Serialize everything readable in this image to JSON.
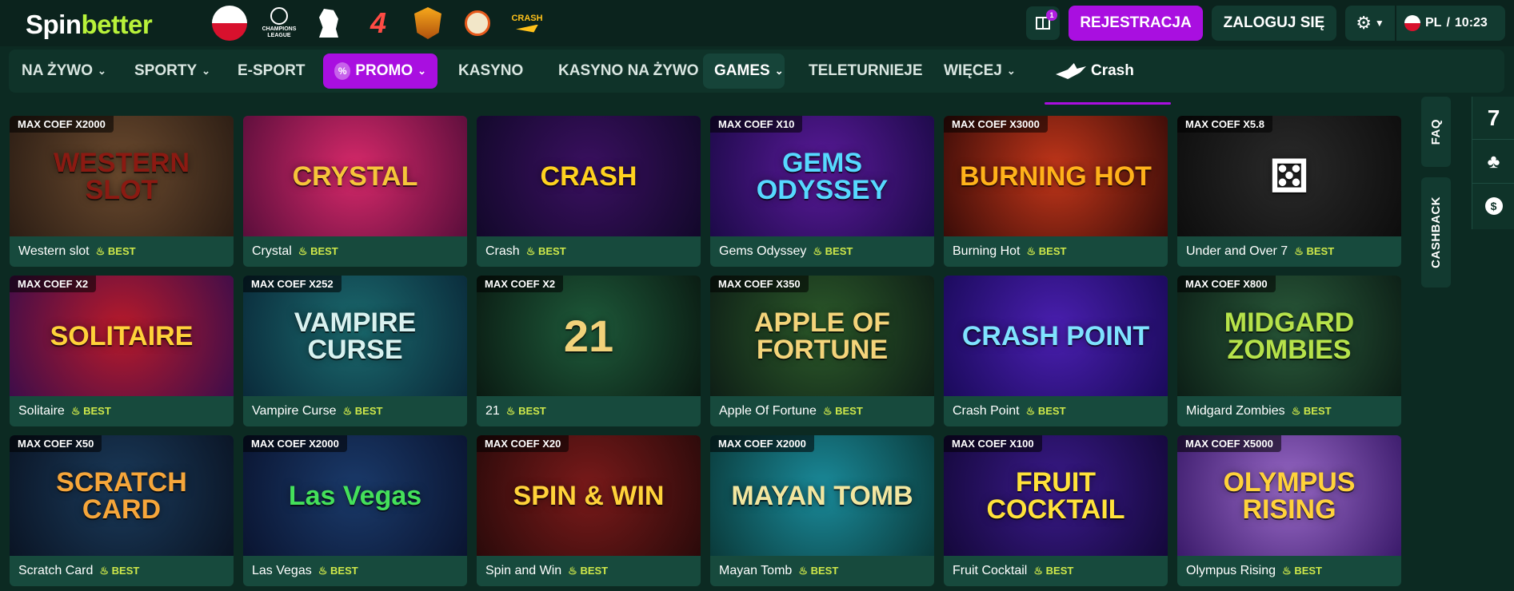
{
  "brand": {
    "logo_part1": "Spin",
    "logo_part2": "better"
  },
  "promo_icons": [
    {
      "name": "poland-flag-icon"
    },
    {
      "name": "champions-league-icon",
      "label": "CHAMPIONS LEAGUE"
    },
    {
      "name": "premier-league-icon"
    },
    {
      "name": "laliga-icon"
    },
    {
      "name": "olympus-icon"
    },
    {
      "name": "chicken-icon"
    },
    {
      "name": "crash-promo-icon",
      "label": "CRASH"
    }
  ],
  "header": {
    "gift_count": "1",
    "register_label": "REJESTRACJA",
    "login_label": "ZALOGUJ SIĘ",
    "lang_label": "PL",
    "separator": "/",
    "time": "10:23"
  },
  "nav": {
    "items": [
      {
        "label": "NA ŻYWO"
      },
      {
        "label": "SPORTY"
      },
      {
        "label": "E-SPORT"
      },
      {
        "label": "PROMO"
      },
      {
        "label": "KASYNO"
      },
      {
        "label": "KASYNO NA ŻYWO"
      },
      {
        "label": "GAMES"
      },
      {
        "label": "TELETURNIEJE"
      },
      {
        "label": "WIĘCEJ"
      },
      {
        "label": "Crash"
      }
    ]
  },
  "games": [
    {
      "name": "Western slot",
      "coef": "MAX COEF X2000",
      "art": "WESTERN SLOT",
      "best": "BEST",
      "colors": [
        "#6b4a2e",
        "#2b1d14"
      ],
      "art_color": "#8b1a12"
    },
    {
      "name": "Crystal",
      "coef": "",
      "art": "CRYSTAL",
      "best": "BEST",
      "colors": [
        "#d7296a",
        "#5a0e3b"
      ],
      "art_color": "#f6c53a"
    },
    {
      "name": "Crash",
      "coef": "",
      "art": "CRASH",
      "best": "BEST",
      "colors": [
        "#3a1060",
        "#12082a"
      ],
      "art_color": "#ffd21f"
    },
    {
      "name": "Gems Odyssey",
      "coef": "MAX COEF X10",
      "art": "GEMS ODYSSEY",
      "best": "BEST",
      "colors": [
        "#5a1a9a",
        "#1c0a48"
      ],
      "art_color": "#56d9ff"
    },
    {
      "name": "Burning Hot",
      "coef": "MAX COEF X3000",
      "art": "BURNING HOT",
      "best": "BEST",
      "colors": [
        "#c2361a",
        "#3a0c08"
      ],
      "art_color": "#ffb21a"
    },
    {
      "name": "Under and Over 7",
      "coef": "MAX COEF X5.8",
      "art": "⚄",
      "best": "BEST",
      "colors": [
        "#2a2a2a",
        "#0d0d0d"
      ],
      "art_color": "#ffffff"
    },
    {
      "name": "Solitaire",
      "coef": "MAX COEF X2",
      "art": "SOLITAIRE",
      "best": "BEST",
      "colors": [
        "#b81a2a",
        "#3d0d4a"
      ],
      "art_color": "#ffd23a"
    },
    {
      "name": "Vampire Curse",
      "coef": "MAX COEF X252",
      "art": "VAMPIRE CURSE",
      "best": "BEST",
      "colors": [
        "#1b6a6e",
        "#0a2a3a"
      ],
      "art_color": "#d9f2f0"
    },
    {
      "name": "21",
      "coef": "MAX COEF X2",
      "art": "21",
      "best": "BEST",
      "colors": [
        "#1e5a3a",
        "#0a1a12"
      ],
      "art_color": "#f2d27a"
    },
    {
      "name": "Apple Of Fortune",
      "coef": "MAX COEF X350",
      "art": "APPLE OF FORTUNE",
      "best": "BEST",
      "colors": [
        "#2c5a2a",
        "#0e1e16"
      ],
      "art_color": "#f4d47a"
    },
    {
      "name": "Crash Point",
      "coef": "",
      "art": "CRASH POINT",
      "best": "BEST",
      "colors": [
        "#4a1fb0",
        "#1a0a5a"
      ],
      "art_color": "#7fe3ff"
    },
    {
      "name": "Midgard Zombies",
      "coef": "MAX COEF X800",
      "art": "MIDGARD ZOMBIES",
      "best": "BEST",
      "colors": [
        "#2a5a3a",
        "#0c1e16"
      ],
      "art_color": "#b6e24a"
    },
    {
      "name": "Scratch Card",
      "coef": "MAX COEF X50",
      "art": "SCRATCH CARD",
      "best": "BEST",
      "colors": [
        "#1a3a5a",
        "#0a1424"
      ],
      "art_color": "#f6a63a"
    },
    {
      "name": "Las Vegas",
      "coef": "MAX COEF X2000",
      "art": "Las Vegas",
      "best": "BEST",
      "colors": [
        "#1a3a6a",
        "#0a1430"
      ],
      "art_color": "#44e05a"
    },
    {
      "name": "Spin and Win",
      "coef": "MAX COEF X20",
      "art": "SPIN & WIN",
      "best": "BEST",
      "colors": [
        "#7a1a1a",
        "#2a0a0a"
      ],
      "art_color": "#ffd23a"
    },
    {
      "name": "Mayan Tomb",
      "coef": "MAX COEF X2000",
      "art": "MAYAN TOMB",
      "best": "BEST",
      "colors": [
        "#1a8a9a",
        "#0a3a3a"
      ],
      "art_color": "#f2e6a0"
    },
    {
      "name": "Fruit Cocktail",
      "coef": "MAX COEF X100",
      "art": "FRUIT COCKTAIL",
      "best": "BEST",
      "colors": [
        "#3a1a8a",
        "#14083a"
      ],
      "art_color": "#ffe23a"
    },
    {
      "name": "Olympus Rising",
      "coef": "MAX COEF X5000",
      "art": "OLYMPUS RISING",
      "best": "BEST",
      "colors": [
        "#9a6ac8",
        "#3a1a6a"
      ],
      "art_color": "#ffd23a"
    }
  ],
  "side": {
    "faq_label": "FAQ",
    "cashback_label": "CASHBACK",
    "seven_label": "7",
    "dollar_label": "$"
  },
  "colors": {
    "accent": "#a90fe0",
    "brand_green": "#b8f23a",
    "background": "#0c2a22",
    "card": "#174a3d"
  }
}
